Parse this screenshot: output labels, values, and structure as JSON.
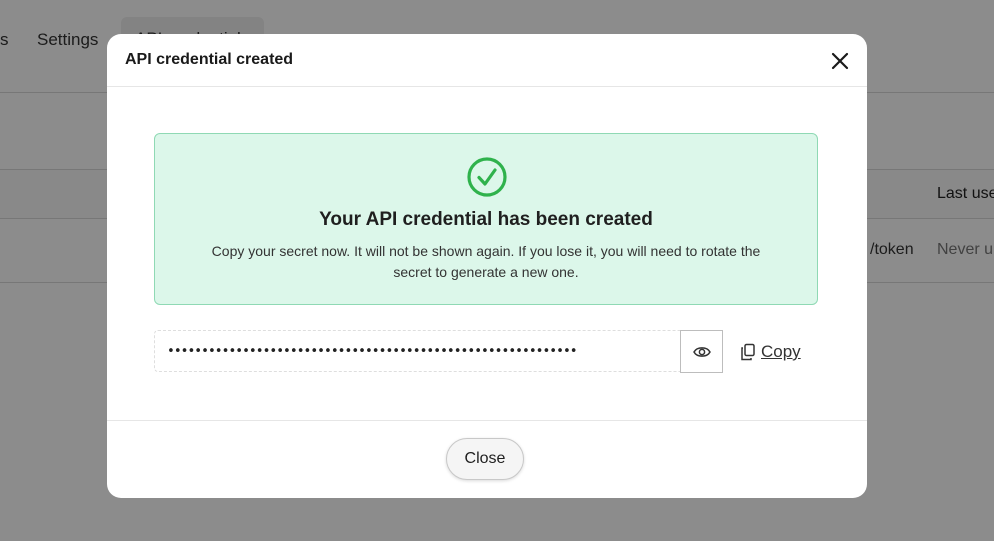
{
  "background": {
    "tabs": [
      {
        "label": "s"
      },
      {
        "label": "Settings"
      },
      {
        "label": "API credentials"
      }
    ],
    "table": {
      "column_last_used": "Last use",
      "cell_endpoint": "/token",
      "cell_last_used": "Never u"
    }
  },
  "modal": {
    "title": "API credential created",
    "success": {
      "title": "Your API credential has been created",
      "text": "Copy your secret now. It will not be shown again. If you lose it, you will need to rotate the secret to generate a new one."
    },
    "secret": {
      "masked_value": "••••••••••••••••••••••••••••••••••••••••••••••••••••••••••••"
    },
    "copy_label": "Copy",
    "close_label": "Close",
    "colors": {
      "success_bg": "#dcf7ea",
      "success_border": "#8fd9b4",
      "check": "#2fb24c"
    }
  }
}
